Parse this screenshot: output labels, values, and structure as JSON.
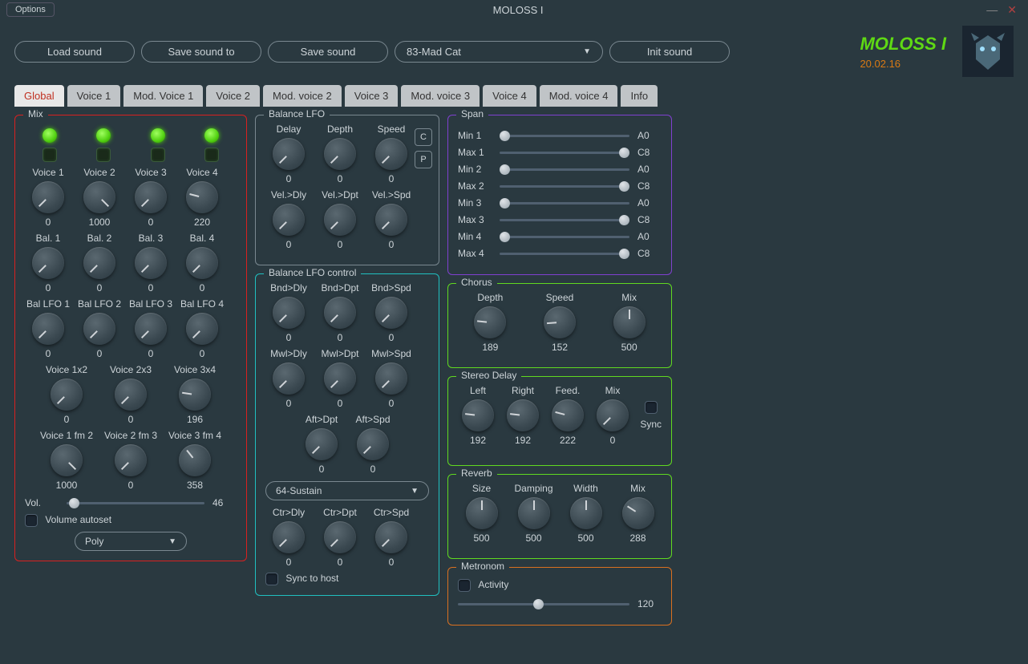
{
  "title": "MOLOSS I",
  "options": "Options",
  "toolbar": {
    "load": "Load sound",
    "save_to": "Save sound to",
    "save": "Save sound",
    "preset": "83-Mad Cat",
    "init": "Init sound"
  },
  "brand": {
    "title": "MOLOSS I",
    "version": "20.02.16"
  },
  "tabs": [
    "Global",
    "Voice 1",
    "Mod. Voice 1",
    "Voice 2",
    "Mod. voice 2",
    "Voice 3",
    "Mod. voice 3",
    "Voice 4",
    "Mod. voice 4",
    "Info"
  ],
  "mix": {
    "title": "Mix",
    "voices": [
      {
        "label": "Voice 1",
        "val": "0"
      },
      {
        "label": "Voice 2",
        "val": "1000"
      },
      {
        "label": "Voice 3",
        "val": "0"
      },
      {
        "label": "Voice 4",
        "val": "220"
      }
    ],
    "bal": [
      {
        "label": "Bal. 1",
        "val": "0"
      },
      {
        "label": "Bal. 2",
        "val": "0"
      },
      {
        "label": "Bal. 3",
        "val": "0"
      },
      {
        "label": "Bal. 4",
        "val": "0"
      }
    ],
    "ballfo": [
      {
        "label": "Bal LFO 1",
        "val": "0"
      },
      {
        "label": "Bal LFO 2",
        "val": "0"
      },
      {
        "label": "Bal LFO 3",
        "val": "0"
      },
      {
        "label": "Bal LFO 4",
        "val": "0"
      }
    ],
    "cross1": [
      {
        "label": "Voice 1x2",
        "val": "0"
      },
      {
        "label": "Voice 2x3",
        "val": "0"
      },
      {
        "label": "Voice 3x4",
        "val": "196"
      }
    ],
    "cross2": [
      {
        "label": "Voice 1 fm 2",
        "val": "1000"
      },
      {
        "label": "Voice 2 fm 3",
        "val": "0"
      },
      {
        "label": "Voice 3 fm 4",
        "val": "358"
      }
    ],
    "vol_label": "Vol.",
    "vol_val": "46",
    "autoset": "Volume autoset",
    "poly": "Poly"
  },
  "ballfo": {
    "title": "Balance LFO",
    "row1": [
      {
        "label": "Delay",
        "val": "0"
      },
      {
        "label": "Depth",
        "val": "0"
      },
      {
        "label": "Speed",
        "val": "0"
      }
    ],
    "row2": [
      {
        "label": "Vel.>Dly",
        "val": "0"
      },
      {
        "label": "Vel.>Dpt",
        "val": "0"
      },
      {
        "label": "Vel.>Spd",
        "val": "0"
      }
    ],
    "c": "C",
    "p": "P"
  },
  "ballfoctrl": {
    "title": "Balance LFO control",
    "row1": [
      {
        "label": "Bnd>Dly",
        "val": "0"
      },
      {
        "label": "Bnd>Dpt",
        "val": "0"
      },
      {
        "label": "Bnd>Spd",
        "val": "0"
      }
    ],
    "row2": [
      {
        "label": "Mwl>Dly",
        "val": "0"
      },
      {
        "label": "Mwl>Dpt",
        "val": "0"
      },
      {
        "label": "Mwl>Spd",
        "val": "0"
      }
    ],
    "row3": [
      {
        "label": "Aft>Dpt",
        "val": "0"
      },
      {
        "label": "Aft>Spd",
        "val": "0"
      }
    ],
    "controller": "64-Sustain",
    "row4": [
      {
        "label": "Ctr>Dly",
        "val": "0"
      },
      {
        "label": "Ctr>Dpt",
        "val": "0"
      },
      {
        "label": "Ctr>Spd",
        "val": "0"
      }
    ],
    "sync": "Sync to host"
  },
  "span": {
    "title": "Span",
    "rows": [
      {
        "label": "Min 1",
        "val": "A0",
        "pos": 0
      },
      {
        "label": "Max 1",
        "val": "C8",
        "pos": 100
      },
      {
        "label": "Min 2",
        "val": "A0",
        "pos": 0
      },
      {
        "label": "Max 2",
        "val": "C8",
        "pos": 100
      },
      {
        "label": "Min 3",
        "val": "A0",
        "pos": 0
      },
      {
        "label": "Max 3",
        "val": "C8",
        "pos": 100
      },
      {
        "label": "Min 4",
        "val": "A0",
        "pos": 0
      },
      {
        "label": "Max 4",
        "val": "C8",
        "pos": 100
      }
    ]
  },
  "chorus": {
    "title": "Chorus",
    "knobs": [
      {
        "label": "Depth",
        "val": "189"
      },
      {
        "label": "Speed",
        "val": "152"
      },
      {
        "label": "Mix",
        "val": "500"
      }
    ]
  },
  "delay": {
    "title": "Stereo Delay",
    "knobs": [
      {
        "label": "Left",
        "val": "192"
      },
      {
        "label": "Right",
        "val": "192"
      },
      {
        "label": "Feed.",
        "val": "222"
      },
      {
        "label": "Mix",
        "val": "0"
      }
    ],
    "sync": "Sync"
  },
  "reverb": {
    "title": "Reverb",
    "knobs": [
      {
        "label": "Size",
        "val": "500"
      },
      {
        "label": "Damping",
        "val": "500"
      },
      {
        "label": "Width",
        "val": "500"
      },
      {
        "label": "Mix",
        "val": "288"
      }
    ]
  },
  "metro": {
    "title": "Metronom",
    "activity": "Activity",
    "val": "120"
  }
}
